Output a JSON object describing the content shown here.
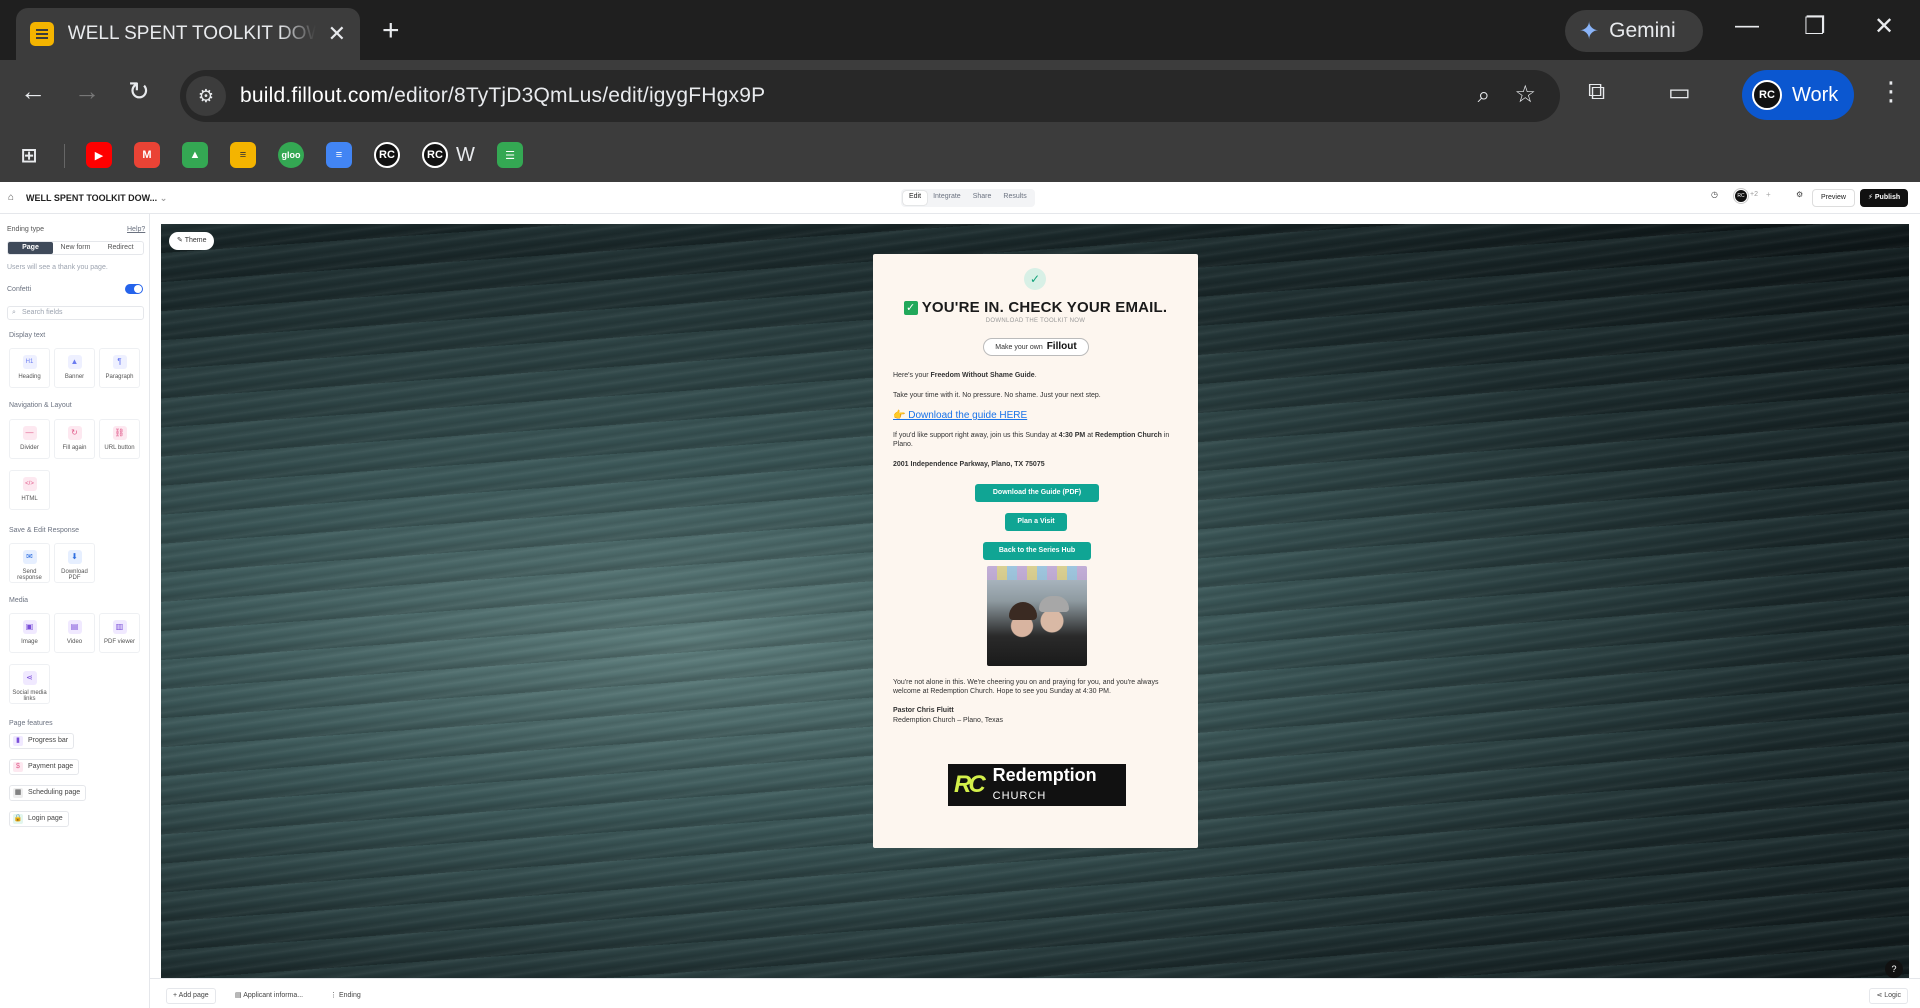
{
  "browser": {
    "tab_title": "WELL SPENT TOOLKIT DOWNLOAD",
    "gemini_label": "Gemini",
    "url_host": "build.fillout.com",
    "url_path": "/editor/8TyTjD3QmLus/edit/igygFHgx9P",
    "profile_label": "Work",
    "profile_initials": "RC",
    "bookmarks": [
      {
        "icon": "youtube-icon",
        "color": "#ff0000"
      },
      {
        "icon": "gmail-icon",
        "color": "#ea4335"
      },
      {
        "icon": "google-drive-icon",
        "color": "#34a853"
      },
      {
        "icon": "fillout-icon",
        "color": "#f4b400"
      },
      {
        "icon": "gloo-icon",
        "color": "#34a853",
        "text": "gloo"
      },
      {
        "icon": "google-docs-icon",
        "color": "#4285f4"
      },
      {
        "icon": "rc-icon",
        "color": "#111111"
      },
      {
        "icon": "rc-icon",
        "color": "#111111"
      },
      {
        "icon": "sheets-icon",
        "color": "#34a853"
      }
    ],
    "bookmark_w_label": "W"
  },
  "app_header": {
    "form_name": "WELL SPENT TOOLKIT DOW...",
    "modes": [
      "Edit",
      "Integrate",
      "Share",
      "Results"
    ],
    "active_mode": "Edit",
    "collaborator_count": "+2",
    "preview_label": "Preview",
    "publish_label": "Publish"
  },
  "left_panel": {
    "ending_type_label": "Ending type",
    "help_label": "Help?",
    "ending_types": [
      "Page",
      "New form",
      "Redirect"
    ],
    "ending_hint": "Users will see a thank you page.",
    "confetti_label": "Confetti",
    "confetti_on": true,
    "search_placeholder": "Search fields",
    "sections": {
      "display_text": "Display text",
      "navigation": "Navigation & Layout",
      "save_edit": "Save & Edit Response",
      "media": "Media",
      "page_features": "Page features"
    },
    "display_text_items": [
      "Heading",
      "Banner",
      "Paragraph"
    ],
    "navigation_items": [
      "Divider",
      "Fill again",
      "URL button",
      "HTML"
    ],
    "save_edit_items": [
      "Send response",
      "Download PDF"
    ],
    "media_items": [
      "Image",
      "Video",
      "PDF viewer",
      "Social media links"
    ],
    "page_features": [
      "Progress bar",
      "Payment page",
      "Scheduling page",
      "Login page"
    ]
  },
  "canvas": {
    "theme_label": "Theme",
    "card": {
      "title": "YOU'RE IN. CHECK YOUR EMAIL.",
      "subtitle": "DOWNLOAD THE TOOLKIT NOW",
      "fillout_pill_prefix": "Make your own",
      "fillout_pill_brand": "Fillout",
      "line1_prefix": "Here's your ",
      "line1_bold": "Freedom Without Shame Guide",
      "line1_suffix": ".",
      "line2": "Take your time with it. No pressure. No shame. Just your next step.",
      "download_link": "👉 Download the guide HERE",
      "visit_prefix": "If you'd like support right away, join us this Sunday at ",
      "visit_time": "4:30 PM",
      "visit_mid": " at ",
      "visit_place": "Redemption Church",
      "visit_suffix": " in Plano.",
      "address": "2001 Independence Parkway, Plano, TX 75075",
      "buttons": [
        "Download the Guide (PDF)",
        "Plan a Visit",
        "Back to the Series Hub"
      ],
      "closing": "You're not alone in this. We're cheering you on and praying for you, and you're always welcome at Redemption Church. Hope to see you Sunday at 4:30 PM.",
      "signature_name": "Pastor Chris Fluitt",
      "signature_place": "Redemption Church – Plano, Texas",
      "logo_mark": "RC",
      "logo_name": "Redemption",
      "logo_sub": "CHURCH"
    }
  },
  "bottom_bar": {
    "add_page": "Add page",
    "pages": [
      "Applicant informa...",
      "Ending"
    ],
    "logic_label": "Logic"
  }
}
